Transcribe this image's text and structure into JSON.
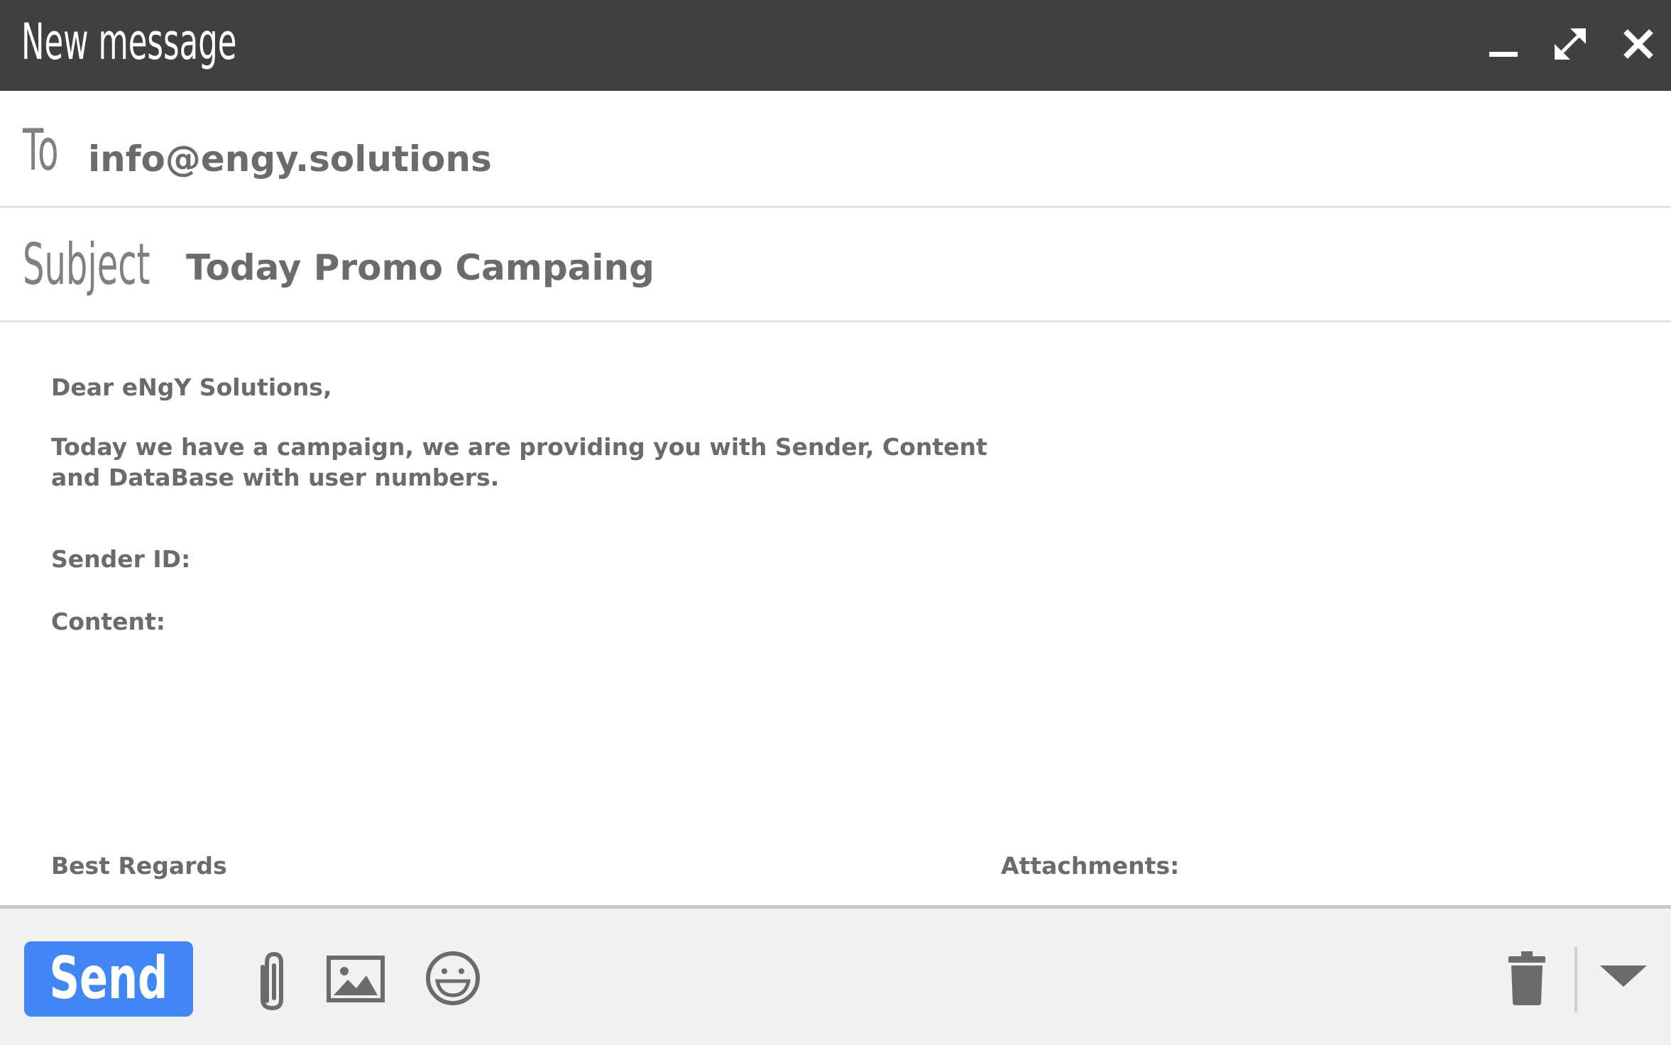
{
  "window": {
    "title": "New message",
    "controls": {
      "minimize": "minimize-icon",
      "expand": "expand-icon",
      "close": "close-icon"
    }
  },
  "fields": {
    "to_label": "To",
    "to_value": "info@engy.solutions",
    "subject_label": "Subject",
    "subject_value": "Today Promo Campaing"
  },
  "body": {
    "greeting": "Dear eNgY Solutions,",
    "paragraph_line1": "Today we have a campaign, we are providing you with Sender, Content",
    "paragraph_line2": "and DataBase with user numbers.",
    "sender_id_label": "Sender ID:",
    "content_label": "Content:",
    "regards": "Best Regards",
    "attachments_label": "Attachments:"
  },
  "toolbar": {
    "send_label": "Send",
    "icons": [
      "paperclip-icon",
      "image-icon",
      "emoji-icon",
      "trash-icon",
      "dropdown-arrow-icon"
    ]
  },
  "colors": {
    "titlebar": "#404040",
    "send_button": "#4285f4",
    "text": "#6b6b6b",
    "toolbar_bg": "#f0f1f0"
  }
}
